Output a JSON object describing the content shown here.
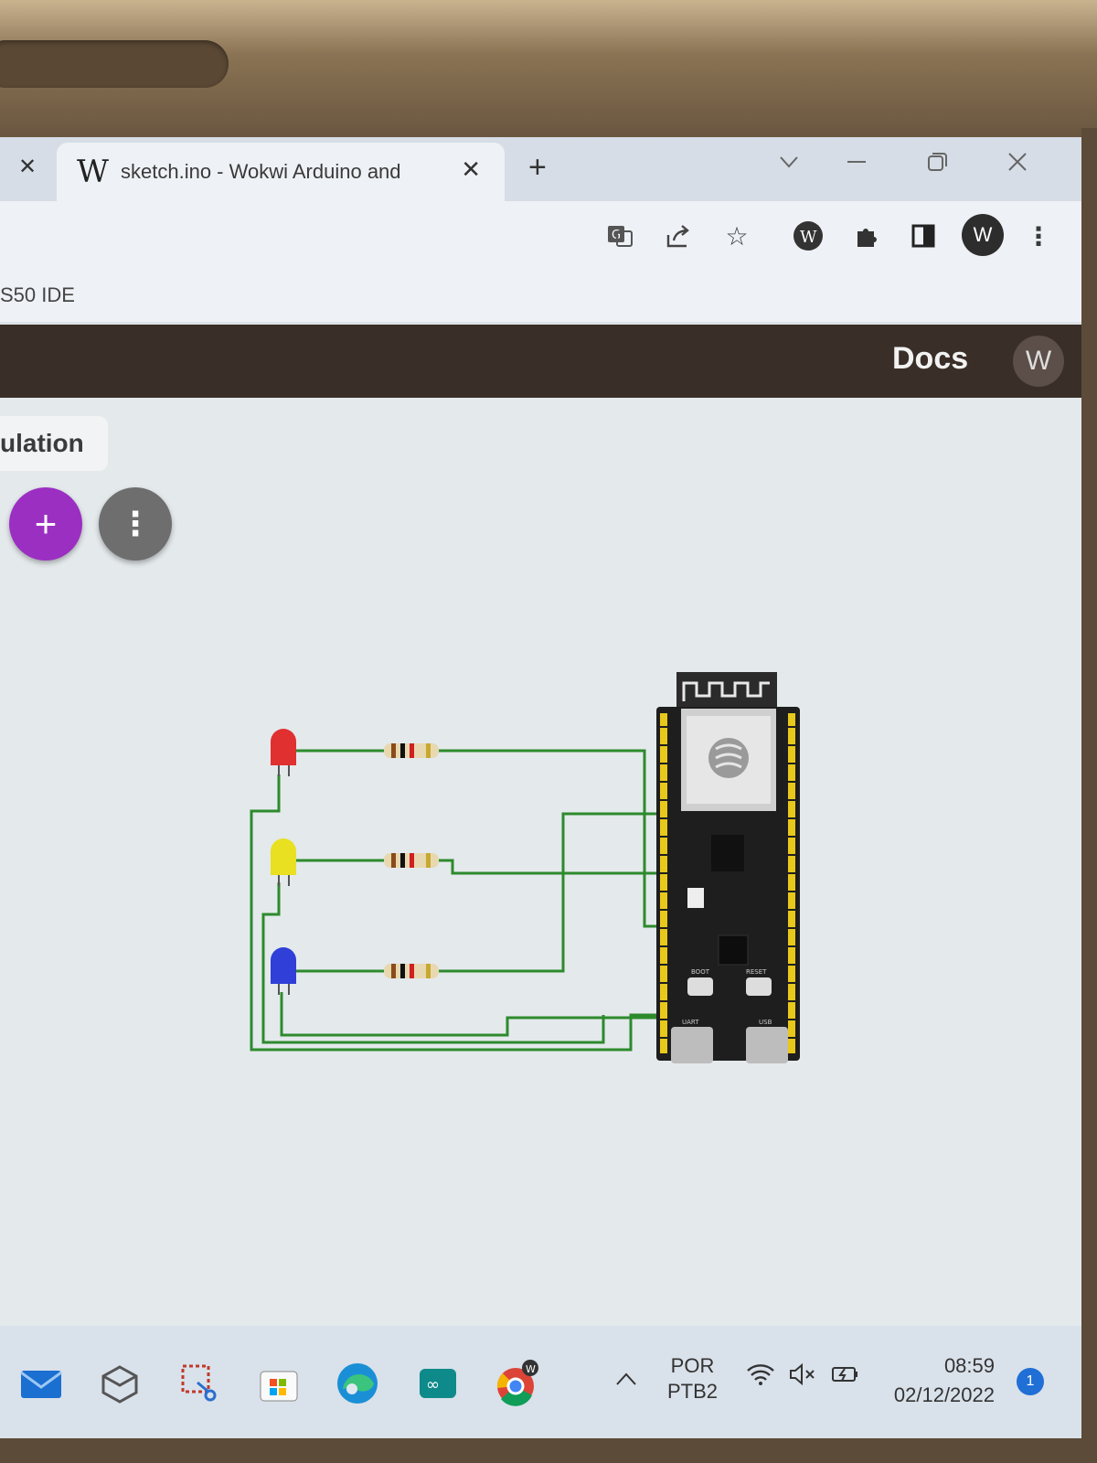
{
  "browser": {
    "active_tab_title": "sketch.ino - Wokwi Arduino and",
    "bookmark_text": "S50 IDE",
    "profile_initial": "W"
  },
  "app": {
    "docs_label": "Docs",
    "user_initial": "W",
    "simulation_tab_label": "ulation"
  },
  "fabs": {
    "add_label": "+",
    "more_label": "⋮"
  },
  "circuit": {
    "board": "ESP32 DevKit",
    "board_button_labels": [
      "BOOT",
      "RESET"
    ],
    "board_port_labels": [
      "UART",
      "USB"
    ],
    "leds": [
      {
        "color_name": "red",
        "color": "#e03030"
      },
      {
        "color_name": "yellow",
        "color": "#e8e020"
      },
      {
        "color_name": "blue",
        "color": "#2f3fd8"
      }
    ],
    "wire_color": "#2d8a2d"
  },
  "taskbar": {
    "language_line1": "POR",
    "language_line2": "PTB2",
    "time": "08:59",
    "date": "02/12/2022",
    "notification_count": "1",
    "chrome_badge": "W"
  }
}
